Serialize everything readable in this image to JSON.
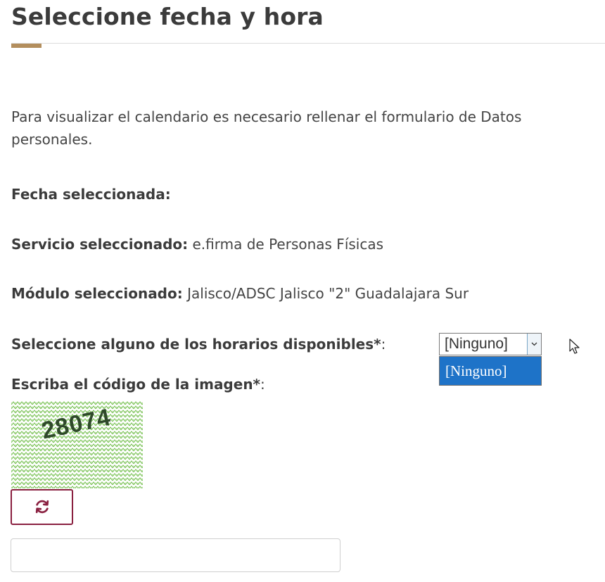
{
  "page": {
    "title": "Seleccione fecha y hora",
    "intro": "Para visualizar el calendario es necesario rellenar el formulario de Datos personales."
  },
  "fields": {
    "fecha": {
      "label": "Fecha seleccionada:",
      "value": ""
    },
    "servicio": {
      "label": "Servicio seleccionado:",
      "value": "e.firma de Personas Físicas"
    },
    "modulo": {
      "label": "Módulo seleccionado:",
      "value": "Jalisco/ADSC Jalisco \"2\" Guadalajara Sur"
    }
  },
  "horario": {
    "label": "Seleccione alguno de los horarios disponibles*",
    "suffix": ":",
    "selected": "[Ninguno]",
    "options": [
      "[Ninguno]"
    ]
  },
  "codigo": {
    "label": "Escriba el código de la imagen*",
    "suffix": ":",
    "captcha_text": "28074",
    "input_value": "",
    "refresh_icon": "refresh-icon"
  },
  "colors": {
    "accent": "#b38e5d",
    "button_border": "#8a2040",
    "dropdown_highlight": "#1e73c8",
    "captcha_text": "#2f4a2a",
    "captcha_noise": "#6fbf4a"
  }
}
